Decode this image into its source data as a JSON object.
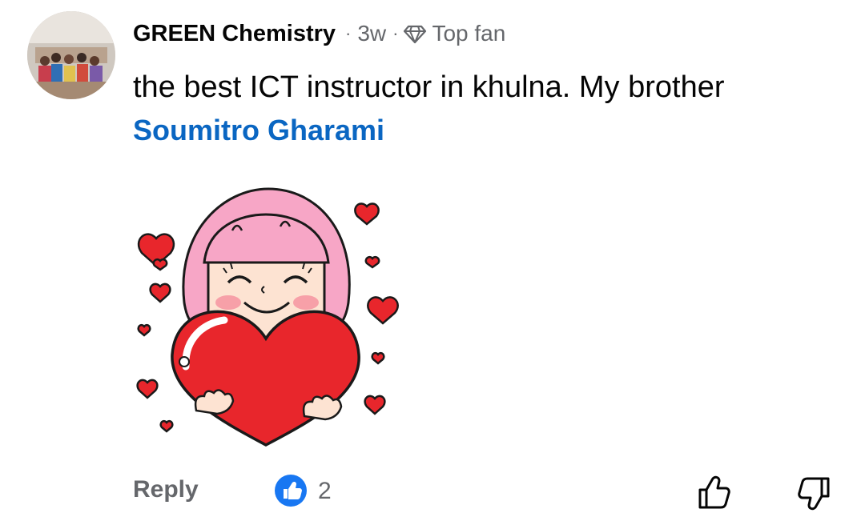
{
  "comment": {
    "author": "GREEN Chemistry",
    "time": "3w",
    "separator": "·",
    "badge_icon": "diamond-icon",
    "badge_label": "Top fan",
    "text": "the best ICT instructor in khulna. My brother",
    "mention": "Soumitro Gharami",
    "sticker": "heart-girl-sticker"
  },
  "actions": {
    "reply_label": "Reply",
    "reaction_icon": "like-reaction-icon",
    "reaction_count": "2",
    "like_icon": "thumbs-up-icon",
    "dislike_icon": "thumbs-down-icon"
  },
  "colors": {
    "mention": "#0a66c2",
    "reaction_blue": "#1877f2",
    "muted": "#65676b",
    "heart_red": "#e8262c",
    "hair_pink": "#f7a6c6"
  }
}
